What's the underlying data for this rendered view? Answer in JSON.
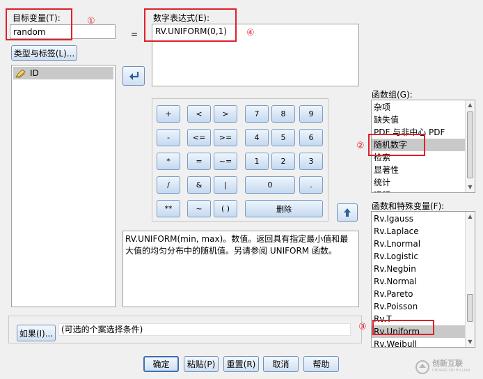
{
  "target": {
    "label": "目标变量(T):",
    "value": "random",
    "equals": "=",
    "type_label_button": "类型与标签(L)..."
  },
  "variables": [
    {
      "name": "ID",
      "icon": "ruler-pencil-icon"
    }
  ],
  "expression": {
    "label": "数字表达式(E):",
    "value": "RV.UNIFORM(0,1)"
  },
  "keypad": {
    "plus": "+",
    "lt": "<",
    "gt": ">",
    "minus": "-",
    "le": "<=",
    "ge": ">=",
    "mult": "*",
    "eq": "=",
    "ne": "~=",
    "div": "/",
    "and": "&",
    "or": "|",
    "pow": "**",
    "not": "~",
    "paren": "( )",
    "d7": "7",
    "d8": "8",
    "d9": "9",
    "d4": "4",
    "d5": "5",
    "d6": "6",
    "d1": "1",
    "d2": "2",
    "d3": "3",
    "d0": "0",
    "dot": ".",
    "delete": "删除"
  },
  "description": "RV.UNIFORM(min, max)。数值。返回具有指定最小值和最大值的均匀分布中的随机值。另请参阅 UNIFORM 函数。",
  "function_groups": {
    "label": "函数组(G):",
    "items": [
      "杂项",
      "缺失值",
      "PDF 与非中心 PDF",
      "随机数字",
      "检索",
      "显著性",
      "统计",
      "运行"
    ],
    "selected_index": 3
  },
  "functions": {
    "label": "函数和特殊变量(F):",
    "items": [
      "Rv.Igauss",
      "Rv.Laplace",
      "Rv.Lnormal",
      "Rv.Logistic",
      "Rv.Negbin",
      "Rv.Normal",
      "Rv.Pareto",
      "Rv.Poisson",
      "Rv.T",
      "Rv.Uniform",
      "Rv.Weibull"
    ],
    "selected_index": 9
  },
  "condition": {
    "if_button": "如果(I)...",
    "text": "(可选的个案选择条件)"
  },
  "footer": {
    "ok": "确定",
    "paste": "粘贴(P)",
    "reset": "重置(R)",
    "cancel": "取消",
    "help": "帮助"
  },
  "annotations": {
    "n1": "①",
    "n2": "②",
    "n3": "③",
    "n4": "④"
  },
  "watermark": {
    "cn": "创新互联",
    "en": "CHUANG XIN HU LIAN"
  },
  "colors": {
    "highlight_red": "#e0202a",
    "button_border": "#6f8fb8",
    "selection_gray": "#c9c9c9"
  }
}
